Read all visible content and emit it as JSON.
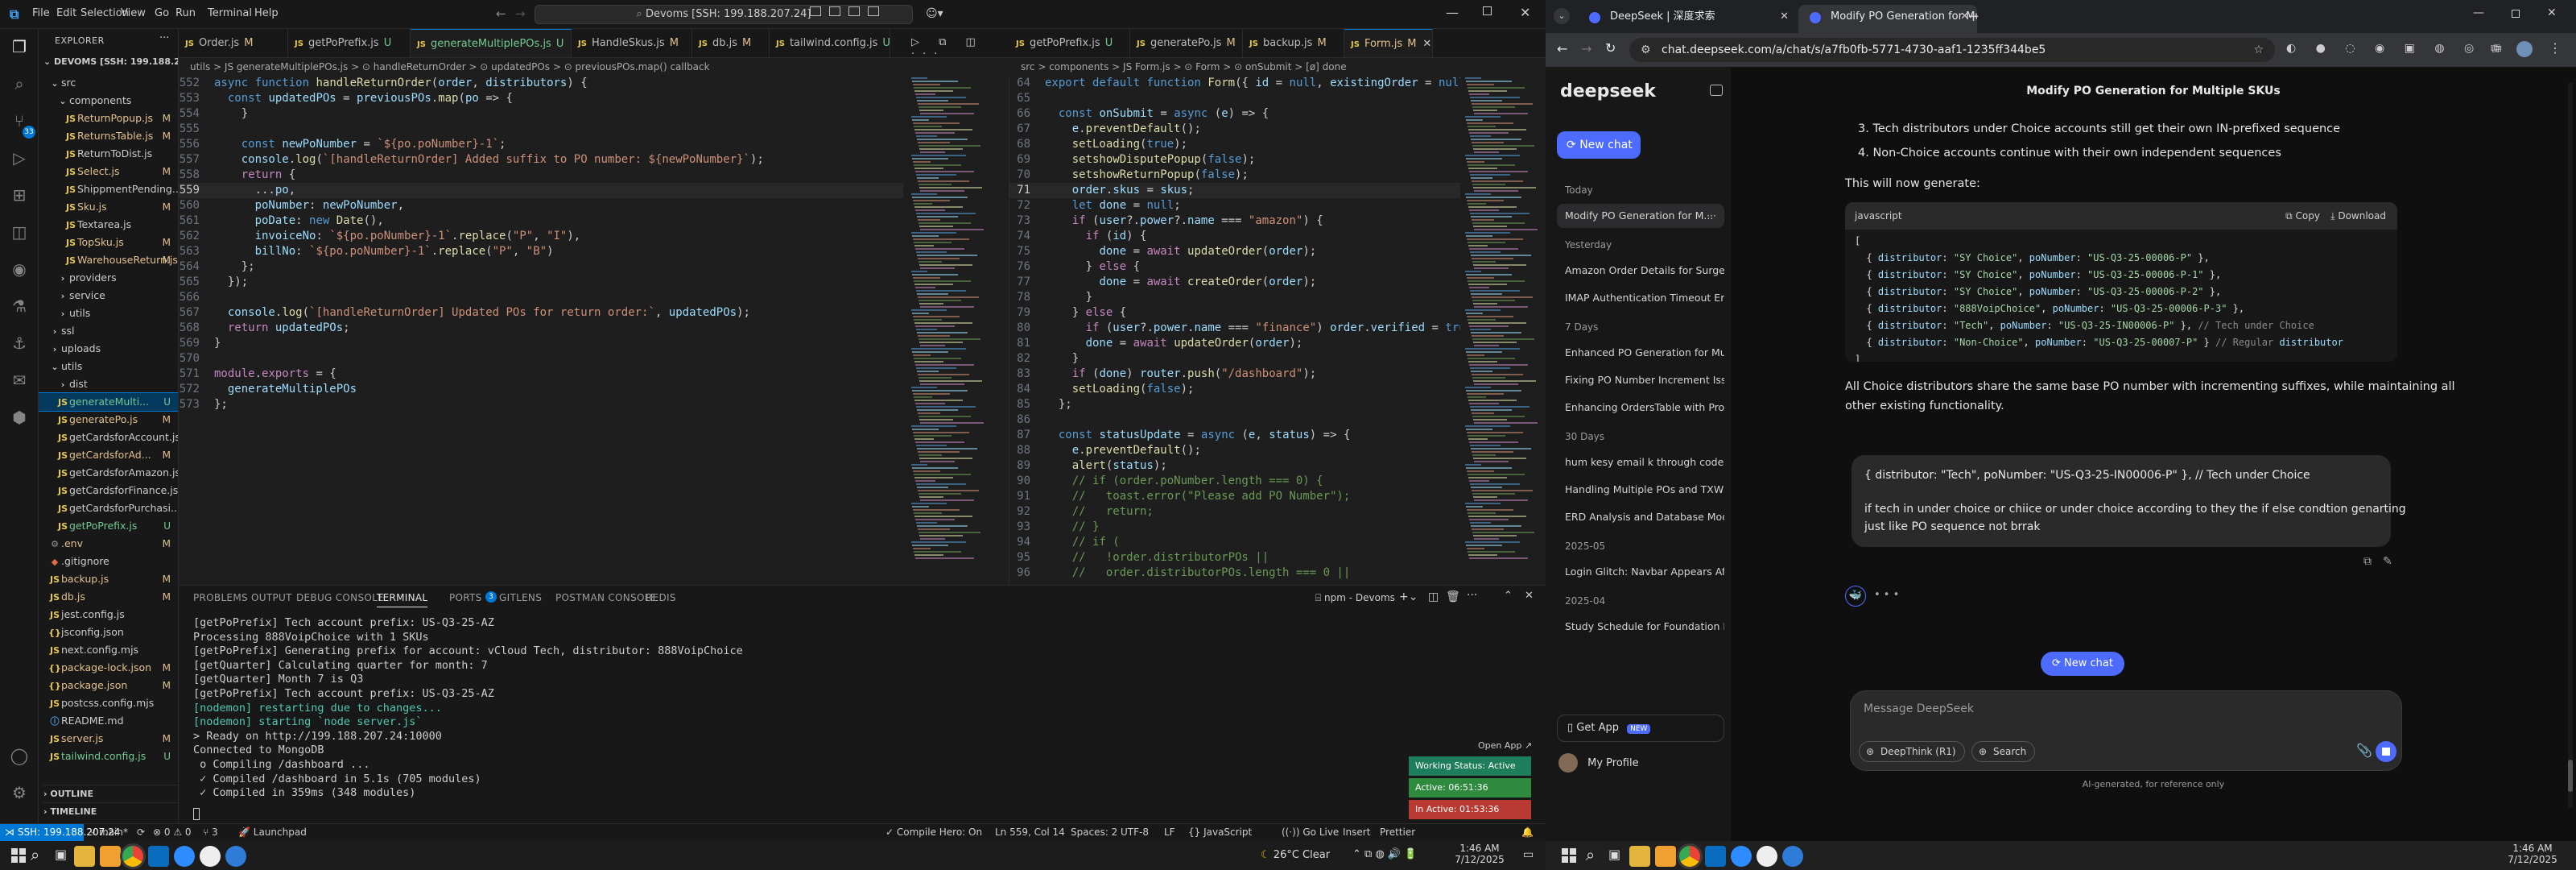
{
  "vscode": {
    "menu": [
      "File",
      "Edit",
      "Selection",
      "View",
      "Go",
      "Run",
      "Terminal",
      "Help"
    ],
    "command_center": "Devoms [SSH: 199.188.207.24]",
    "explorer": {
      "title": "EXPLORER",
      "root": "DEVOMS [SSH: 199.188.20...",
      "rows": [
        {
          "indent": 1,
          "type": "folder-open",
          "label": "src",
          "badge": ""
        },
        {
          "indent": 2,
          "type": "folder-open",
          "label": "components",
          "badge": ""
        },
        {
          "indent": 3,
          "type": "js",
          "label": "ReturnPopup.js",
          "badge": "M"
        },
        {
          "indent": 3,
          "type": "js",
          "label": "ReturnsTable.js",
          "badge": "M"
        },
        {
          "indent": 3,
          "type": "js",
          "label": "ReturnToDist.js",
          "badge": ""
        },
        {
          "indent": 3,
          "type": "js",
          "label": "Select.js",
          "badge": "M"
        },
        {
          "indent": 3,
          "type": "js",
          "label": "ShippmentPending...",
          "badge": ""
        },
        {
          "indent": 3,
          "type": "js",
          "label": "Sku.js",
          "badge": "M"
        },
        {
          "indent": 3,
          "type": "js",
          "label": "Textarea.js",
          "badge": ""
        },
        {
          "indent": 3,
          "type": "js",
          "label": "TopSku.js",
          "badge": "M"
        },
        {
          "indent": 3,
          "type": "js",
          "label": "WarehouseReturn.js",
          "badge": "M"
        },
        {
          "indent": 2,
          "type": "folder",
          "label": "providers",
          "badge": ""
        },
        {
          "indent": 2,
          "type": "folder",
          "label": "service",
          "badge": ""
        },
        {
          "indent": 2,
          "type": "folder",
          "label": "utils",
          "badge": ""
        },
        {
          "indent": 1,
          "type": "folder",
          "label": "ssl",
          "badge": ""
        },
        {
          "indent": 1,
          "type": "folder",
          "label": "uploads",
          "badge": ""
        },
        {
          "indent": 1,
          "type": "folder-open",
          "label": "utils",
          "badge": ""
        },
        {
          "indent": 2,
          "type": "folder",
          "label": "dist",
          "badge": ""
        },
        {
          "indent": 2,
          "type": "js",
          "label": "generateMulti...",
          "badge": "U",
          "selected": true
        },
        {
          "indent": 2,
          "type": "js",
          "label": "generatePo.js",
          "badge": "M"
        },
        {
          "indent": 2,
          "type": "js",
          "label": "getCardsforAccount.js",
          "badge": ""
        },
        {
          "indent": 2,
          "type": "js",
          "label": "getCardsforAd...",
          "badge": "M"
        },
        {
          "indent": 2,
          "type": "js",
          "label": "getCardsforAmazon.js",
          "badge": ""
        },
        {
          "indent": 2,
          "type": "js",
          "label": "getCardsforFinance.js",
          "badge": ""
        },
        {
          "indent": 2,
          "type": "js",
          "label": "getCardsforPurchasi...",
          "badge": ""
        },
        {
          "indent": 2,
          "type": "js",
          "label": "getPoPrefix.js",
          "badge": "U"
        },
        {
          "indent": 1,
          "type": "env",
          "label": ".env",
          "badge": "M"
        },
        {
          "indent": 1,
          "type": "git",
          "label": ".gitignore",
          "badge": ""
        },
        {
          "indent": 1,
          "type": "js",
          "label": "backup.js",
          "badge": "M"
        },
        {
          "indent": 1,
          "type": "js",
          "label": "db.js",
          "badge": "M"
        },
        {
          "indent": 1,
          "type": "js",
          "label": "jest.config.js",
          "badge": ""
        },
        {
          "indent": 1,
          "type": "json",
          "label": "jsconfig.json",
          "badge": ""
        },
        {
          "indent": 1,
          "type": "js",
          "label": "next.config.mjs",
          "badge": ""
        },
        {
          "indent": 1,
          "type": "json",
          "label": "package-lock.json",
          "badge": "M"
        },
        {
          "indent": 1,
          "type": "json",
          "label": "package.json",
          "badge": "M"
        },
        {
          "indent": 1,
          "type": "js",
          "label": "postcss.config.mjs",
          "badge": ""
        },
        {
          "indent": 1,
          "type": "md",
          "label": "README.md",
          "badge": ""
        },
        {
          "indent": 1,
          "type": "js",
          "label": "server.js",
          "badge": "M"
        },
        {
          "indent": 1,
          "type": "js",
          "label": "tailwind.config.js",
          "badge": "U"
        }
      ],
      "outline": "OUTLINE",
      "timeline": "TIMELINE"
    },
    "left_tabs": [
      {
        "label": "Order.js",
        "badge": "M",
        "active": false
      },
      {
        "label": "getPoPrefix.js",
        "badge": "U",
        "active": false
      },
      {
        "label": "generateMultiplePOs.js",
        "badge": "U",
        "active": true
      },
      {
        "label": "HandleSkus.js",
        "badge": "M",
        "active": false
      },
      {
        "label": "db.js",
        "badge": "M",
        "active": false
      },
      {
        "label": "tailwind.config.js",
        "badge": "U",
        "active": false
      }
    ],
    "left_breadcrumb": "utils > JS generateMultiplePOs.js > ⊙ handleReturnOrder > ⊙ updatedPOs > ⊙ previousPOs.map() callback",
    "left_code": [
      {
        "n": "552",
        "t": "async function handleReturnOrder(order, distributors) {"
      },
      {
        "n": "553",
        "t": "  const updatedPOs = previousPOs.map(po => {"
      },
      {
        "n": "554",
        "t": "    }"
      },
      {
        "n": "555",
        "t": ""
      },
      {
        "n": "556",
        "t": "    const newPoNumber = `${po.poNumber}-1`;"
      },
      {
        "n": "557",
        "t": "    console.log(`[handleReturnOrder] Added suffix to PO number: ${newPoNumber}`);"
      },
      {
        "n": "558",
        "t": "    return {"
      },
      {
        "n": "559",
        "t": "      ...po,"
      },
      {
        "n": "560",
        "t": "      poNumber: newPoNumber,"
      },
      {
        "n": "561",
        "t": "      poDate: new Date(),"
      },
      {
        "n": "562",
        "t": "      invoiceNo: `${po.poNumber}-1`.replace(\"P\", \"I\"),"
      },
      {
        "n": "563",
        "t": "      billNo: `${po.poNumber}-1`.replace(\"P\", \"B\")"
      },
      {
        "n": "564",
        "t": "    };"
      },
      {
        "n": "565",
        "t": "  });"
      },
      {
        "n": "566",
        "t": ""
      },
      {
        "n": "567",
        "t": "  console.log(`[handleReturnOrder] Updated POs for return order:`, updatedPOs);"
      },
      {
        "n": "568",
        "t": "  return updatedPOs;"
      },
      {
        "n": "569",
        "t": "}"
      },
      {
        "n": "570",
        "t": ""
      },
      {
        "n": "571",
        "t": "module.exports = {"
      },
      {
        "n": "572",
        "t": "  generateMultiplePOs"
      },
      {
        "n": "573",
        "t": "};"
      }
    ],
    "right_tabs": [
      {
        "label": "getPoPrefix.js",
        "badge": "U",
        "active": false
      },
      {
        "label": "generatePo.js",
        "badge": "M",
        "active": false
      },
      {
        "label": "backup.js",
        "badge": "M",
        "active": false
      },
      {
        "label": "Form.js",
        "badge": "M",
        "active": true
      }
    ],
    "right_breadcrumb": "src > components > JS Form.js > ⊙ Form > ⊙ onSubmit > [ø] done",
    "right_code": [
      {
        "n": "64",
        "t": "export default function Form({ id = null, existingOrder = null, dispute = false }"
      },
      {
        "n": "65",
        "t": ""
      },
      {
        "n": "66",
        "t": "  const onSubmit = async (e) => {"
      },
      {
        "n": "67",
        "t": "    e.preventDefault();"
      },
      {
        "n": "68",
        "t": "    setLoading(true);"
      },
      {
        "n": "69",
        "t": "    setshowDisputePopup(false);"
      },
      {
        "n": "70",
        "t": "    setshowReturnPopup(false);"
      },
      {
        "n": "71",
        "t": "    order.skus = skus;"
      },
      {
        "n": "72",
        "t": "    let done = null;"
      },
      {
        "n": "73",
        "t": "    if (user?.power?.name === \"amazon\") {"
      },
      {
        "n": "74",
        "t": "      if (id) {"
      },
      {
        "n": "75",
        "t": "        done = await updateOrder(order);"
      },
      {
        "n": "76",
        "t": "      } else {"
      },
      {
        "n": "77",
        "t": "        done = await createOrder(order);"
      },
      {
        "n": "78",
        "t": "      }"
      },
      {
        "n": "79",
        "t": "    } else {"
      },
      {
        "n": "80",
        "t": "      if (user?.power.name === \"finance\") order.verified = true;"
      },
      {
        "n": "81",
        "t": "      done = await updateOrder(order);"
      },
      {
        "n": "82",
        "t": "    }"
      },
      {
        "n": "83",
        "t": "    if (done) router.push(\"/dashboard\");"
      },
      {
        "n": "84",
        "t": "    setLoading(false);"
      },
      {
        "n": "85",
        "t": "  };"
      },
      {
        "n": "86",
        "t": ""
      },
      {
        "n": "87",
        "t": "  const statusUpdate = async (e, status) => {"
      },
      {
        "n": "88",
        "t": "    e.preventDefault();"
      },
      {
        "n": "89",
        "t": "    alert(status);"
      },
      {
        "n": "90",
        "t": "    // if (order.poNumber.length === 0) {"
      },
      {
        "n": "91",
        "t": "    //   toast.error(\"Please add PO Number\");"
      },
      {
        "n": "92",
        "t": "    //   return;"
      },
      {
        "n": "93",
        "t": "    // }"
      },
      {
        "n": "94",
        "t": "    // if ("
      },
      {
        "n": "95",
        "t": "    //   !order.distributorPOs ||"
      },
      {
        "n": "96",
        "t": "    //   order.distributorPOs.length === 0 ||"
      }
    ],
    "panel_tabs": [
      "PROBLEMS",
      "OUTPUT",
      "DEBUG CONSOLE",
      "TERMINAL",
      "PORTS",
      "GITLENS",
      "POSTMAN CONSOLE",
      "REDIS"
    ],
    "ports_count": "3",
    "terminal_label": "npm - Devoms",
    "terminal_lines": [
      "[getPoPrefix] Tech account prefix: US-Q3-25-AZ",
      "Processing 888VoipChoice with 1 SKUs",
      "[getPoPrefix] Generating prefix for account: vCloud Tech, distributor: 888VoipChoice",
      "[getQuarter] Calculating quarter for month: 7",
      "[getQuarter] Month 7 is Q3",
      "[getPoPrefix] Tech account prefix: US-Q3-25-AZ",
      "[nodemon] restarting due to changes...",
      "[nodemon] starting `node server.js`",
      "> Ready on http://199.188.207.24:10000",
      "Connected to MongoDB",
      " o Compiling /dashboard ...",
      " ✓ Compiled /dashboard in 5.1s (705 modules)",
      " ✓ Compiled in 359ms (348 modules)"
    ],
    "open_app": "Open App ↗",
    "status_widgets": [
      {
        "label": "Working Status: Active",
        "color": "#1e7d5a"
      },
      {
        "label": "Active: 06:51:36",
        "color": "#2e8b3e"
      },
      {
        "label": "In Active: 01:53:36",
        "color": "#b93a32"
      }
    ],
    "statusbar": {
      "remote": "SSH: 199.188.207.24",
      "branch": "main*",
      "sync": "⟳",
      "errors": "⊗ 0 ⚠ 0",
      "ports": "⑂ 3",
      "launchpad": "Launchpad",
      "compile": "Compile Hero: On",
      "position": "Ln 559, Col 14",
      "spaces": "Spaces: 2",
      "encoding": "UTF-8",
      "eol": "LF",
      "lang": "{} JavaScript",
      "golive": "Go Live",
      "insert": "Insert",
      "prettier": "Prettier"
    },
    "taskbar": {
      "weather": "26°C  Clear",
      "time": "1:46 AM",
      "date": "7/12/2025"
    }
  },
  "chrome": {
    "tabs": [
      {
        "label": "DeepSeek | 深度求索",
        "active": false
      },
      {
        "label": "Modify PO Generation for Multi...",
        "active": true
      }
    ],
    "url": "chat.deepseek.com/a/chat/s/a7fb0fb-5771-4730-aaf1-1235ff344be5",
    "sidebar": {
      "logo": "deepseek",
      "new_chat": "New chat",
      "groups": [
        {
          "head": "Today",
          "items": [
            "Modify PO Generation for M..."
          ]
        },
        {
          "head": "Yesterday",
          "items": [
            "Amazon Order Details for Surge",
            "IMAP Authentication Timeout Er"
          ]
        },
        {
          "head": "7 Days",
          "items": [
            "Enhanced PO Generation for Mu",
            "Fixing PO Number Increment Iss",
            "Enhancing OrdersTable with Prof"
          ]
        },
        {
          "head": "30 Days",
          "items": [
            "hum kesy email k through code",
            "Handling Multiple POs and TXW",
            "ERD Analysis and Database Mod"
          ]
        },
        {
          "head": "2025-05",
          "items": [
            "Login Glitch: Navbar Appears Af"
          ]
        },
        {
          "head": "2025-04",
          "items": [
            "Study Schedule for Foundation L"
          ]
        }
      ],
      "get_app": "Get App",
      "new_badge": "NEW",
      "profile": "My Profile"
    },
    "chat": {
      "title": "Modify PO Generation for Multiple SKUs",
      "list_items": [
        "3. Tech distributors under Choice accounts still get their own IN-prefixed sequence",
        "4. Non-Choice accounts continue with their own independent sequences"
      ],
      "intro": "This will now generate:",
      "code_lang": "javascript",
      "copy": "Copy",
      "download": "Download",
      "code_lines": [
        "[",
        "  { distributor: \"SY Choice\", poNumber: \"US-Q3-25-00006-P\" },",
        "  { distributor: \"SY Choice\", poNumber: \"US-Q3-25-00006-P-1\" },",
        "  { distributor: \"SY Choice\", poNumber: \"US-Q3-25-00006-P-2\" },",
        "  { distributor: \"888VoipChoice\", poNumber: \"US-Q3-25-00006-P-3\" },",
        "  { distributor: \"Tech\", poNumber: \"US-Q3-25-IN00006-P\" }, // Tech under Choice",
        "  { distributor: \"Non-Choice\", poNumber: \"US-Q3-25-00007-P\" } // Regular distributor",
        "]"
      ],
      "summary_1": "All Choice distributors share the same base PO number with incrementing suffixes, while maintaining all",
      "summary_2": "other existing functionality.",
      "user_line_1": "{ distributor: \"Tech\", poNumber: \"US-Q3-25-IN00006-P\" }, // Tech under Choice",
      "user_line_2": "if tech in under choice or chiice or under choice according  to they the if else condtion genarting",
      "user_line_3": "just like PO sequence not brrak",
      "thinking": "• • •",
      "new_chat_float": "New chat",
      "input_placeholder": "Message DeepSeek",
      "deepthink": "DeepThink (R1)",
      "search": "Search",
      "disclaimer": "AI-generated, for reference only"
    },
    "taskbar": {
      "time": "1:46 AM",
      "date": "7/12/2025"
    }
  }
}
